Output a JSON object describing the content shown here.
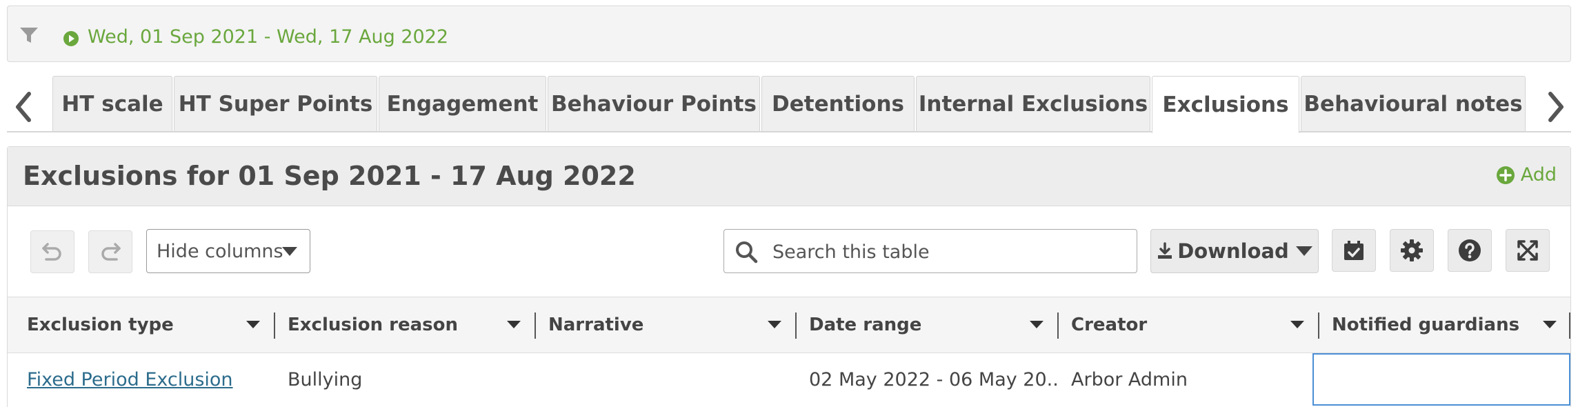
{
  "filter": {
    "date_range": "Wed, 01 Sep 2021 - Wed, 17 Aug 2022",
    "icons": [
      "filter-icon",
      "play-circle-icon"
    ]
  },
  "tabs": [
    {
      "label": "HT scale",
      "active": false
    },
    {
      "label": "HT Super Points",
      "active": false
    },
    {
      "label": "Engagement",
      "active": false
    },
    {
      "label": "Behaviour Points",
      "active": false
    },
    {
      "label": "Detentions",
      "active": false
    },
    {
      "label": "Internal Exclusions",
      "active": false
    },
    {
      "label": "Exclusions",
      "active": true
    },
    {
      "label": "Behavioural notes",
      "active": false
    }
  ],
  "panel": {
    "title": "Exclusions for 01 Sep 2021 - 17 Aug 2022",
    "add_label": "Add"
  },
  "toolbar": {
    "hide_columns_label": "Hide columns",
    "search_placeholder": "Search this table",
    "download_label": "Download",
    "icons": [
      "undo-icon",
      "redo-icon",
      "search-icon",
      "download-icon",
      "calendar-check-icon",
      "gear-icon",
      "help-icon",
      "fullscreen-icon"
    ]
  },
  "table": {
    "columns": [
      "Exclusion type",
      "Exclusion reason",
      "Narrative",
      "Date range",
      "Creator",
      "Notified guardians"
    ],
    "rows": [
      {
        "exclusion_type": "Fixed Period Exclusion",
        "exclusion_reason": "Bullying",
        "narrative": "",
        "date_range": "02 May 2022 - 06 May 20...",
        "creator": "Arbor Admin",
        "notified_guardians": ""
      }
    ]
  },
  "colors": {
    "accent_green": "#6aa73d",
    "link_blue": "#2c6c8c",
    "selection_blue": "#4a8fd6"
  }
}
